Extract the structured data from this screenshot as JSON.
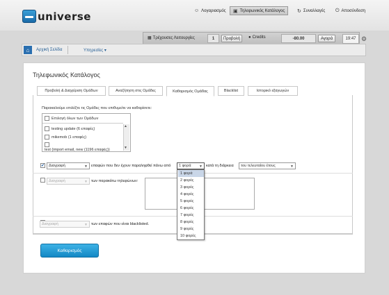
{
  "header": {
    "logo_text": "universe",
    "nav": [
      {
        "label": "Λογαριασμός",
        "icon": "user-icon"
      },
      {
        "label": "Τηλεφωνικός Κατάλογος",
        "icon": "phonebook-icon"
      },
      {
        "label": "Συναλλαγές",
        "icon": "transactions-icon"
      },
      {
        "label": "Αποσύνδεση",
        "icon": "power-icon"
      }
    ]
  },
  "statusbar": {
    "tasks_label": "Τρέχουσες Λειτουργίες",
    "tasks_count": "1",
    "view_label": "Προβολή",
    "credits_label": "Credits",
    "credits_value": "-80.00",
    "buy_label": "Αγορά",
    "clock": "19:47"
  },
  "breadcrumb": {
    "home": "Αρχική Σελίδα",
    "services": "Υπηρεσίες ▾"
  },
  "page": {
    "title": "Τηλεφωνικός Κατάλογος",
    "tabs": [
      "Προβολή & Διαχείριση Ομάδων",
      "Αναζήτηση στις Ομάδες",
      "Καθαρισμός Ομάδας",
      "Blacklist",
      "Ιστορικό εξαγωγών"
    ],
    "instructions": "Παρακαλούμε επιλέξτε τις Ομάδες που επιθυμείτε να καθαρίσετε:",
    "groups": [
      "Επιλογή όλων των Ομάδων",
      "testing update (6 επαφές)",
      "mikemob (1 επαφές)",
      "",
      "test (import email, new (1196 επαφές))"
    ],
    "row1": {
      "action": "Διαγραφή",
      "text1": "επαφών που δεν έχουν παραληφθεί πάνω από",
      "times": "1 φορά",
      "text2": "κατά τη διάρκεια",
      "period": "του τελευταίου έτους"
    },
    "row2": {
      "action": "Διαγραφή",
      "text": "των παρακάτω τηλεφώνων:"
    },
    "row3": {
      "action": "Διαγραφή",
      "text": "των επαφών που είναι blacklisted."
    },
    "dropdown_options": [
      "1 φορά",
      "2 φορές",
      "3 φορές",
      "4 φορές",
      "5 φορές",
      "6 φορές",
      "7 φορές",
      "8 φορές",
      "9 φορές",
      "10 φορές"
    ],
    "clean_button": "Καθαρισμός"
  }
}
